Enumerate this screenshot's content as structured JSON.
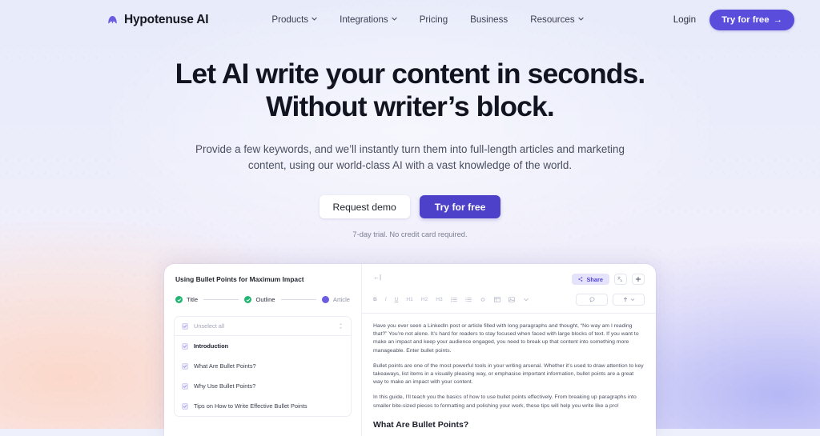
{
  "nav": {
    "brand": "Hypotenuse AI",
    "brand_icon": "hypotenuse-logo-icon",
    "links": [
      {
        "label": "Products",
        "has_chevron": true
      },
      {
        "label": "Integrations",
        "has_chevron": true
      },
      {
        "label": "Pricing",
        "has_chevron": false
      },
      {
        "label": "Business",
        "has_chevron": false
      },
      {
        "label": "Resources",
        "has_chevron": true
      }
    ],
    "login": "Login",
    "cta": "Try for free",
    "cta_arrow": "→"
  },
  "hero": {
    "heading_line1": "Let AI write your content in seconds.",
    "heading_line2": "Without writer’s block.",
    "subheading": "Provide a few keywords, and we’ll instantly turn them into full-length articles and marketing content, using our world-class AI with a vast knowledge of the world.",
    "btn_demo": "Request demo",
    "btn_try": "Try for free",
    "trial_note": "7-day trial. No credit card required."
  },
  "app": {
    "doc_title": "Using Bullet Points for Maximum Impact",
    "stepper": [
      {
        "label": "Title",
        "state": "done"
      },
      {
        "label": "Outline",
        "state": "done"
      },
      {
        "label": "Article",
        "state": "current"
      }
    ],
    "outline": {
      "header_label": "Unselect all",
      "items": [
        {
          "label": "Introduction",
          "bold": true
        },
        {
          "label": "What Are Bullet Points?",
          "bold": false
        },
        {
          "label": "Why Use Bullet Points?",
          "bold": false
        },
        {
          "label": "Tips on How to Write Effective Bullet Points",
          "bold": false
        }
      ]
    },
    "editor": {
      "share_label": "Share",
      "toolbar": [
        "B",
        "I",
        "U",
        "H1",
        "H2",
        "H3",
        "list-bullet-icon",
        "list-ordered-icon",
        "link-icon",
        "table-icon",
        "image-icon",
        "chevron-down-icon"
      ],
      "paragraphs": [
        "Have you ever seen a LinkedIn post or article filled with long paragraphs and thought, “No way am I reading that?” You’re not alone. It’s hard for readers to stay focused when faced with large blocks of text. If you want to make an impact and keep your audience engaged, you need to break up that content into something more manageable. Enter bullet points.",
        "Bullet points are one of the most powerful tools in your writing arsenal. Whether it’s used to draw attention to key takeaways, list items in a visually pleasing way, or emphasise important information, bullet points are a great way to make an impact with your content.",
        "In this guide, I’ll teach you the basics of how to use bullet points effectively. From breaking up paragraphs into smaller bite-sized pieces to formatting and polishing your work, these tips will help you write like a pro!"
      ],
      "subheading": "What Are Bullet Points?"
    }
  },
  "colors": {
    "brand_purple": "#5b4ddb",
    "cta_purple": "#4e41c9",
    "step_done_green": "#22b573",
    "step_current_purple": "#6b5ce0",
    "share_bg": "#e5e3fb",
    "heading_dark": "#121520"
  }
}
